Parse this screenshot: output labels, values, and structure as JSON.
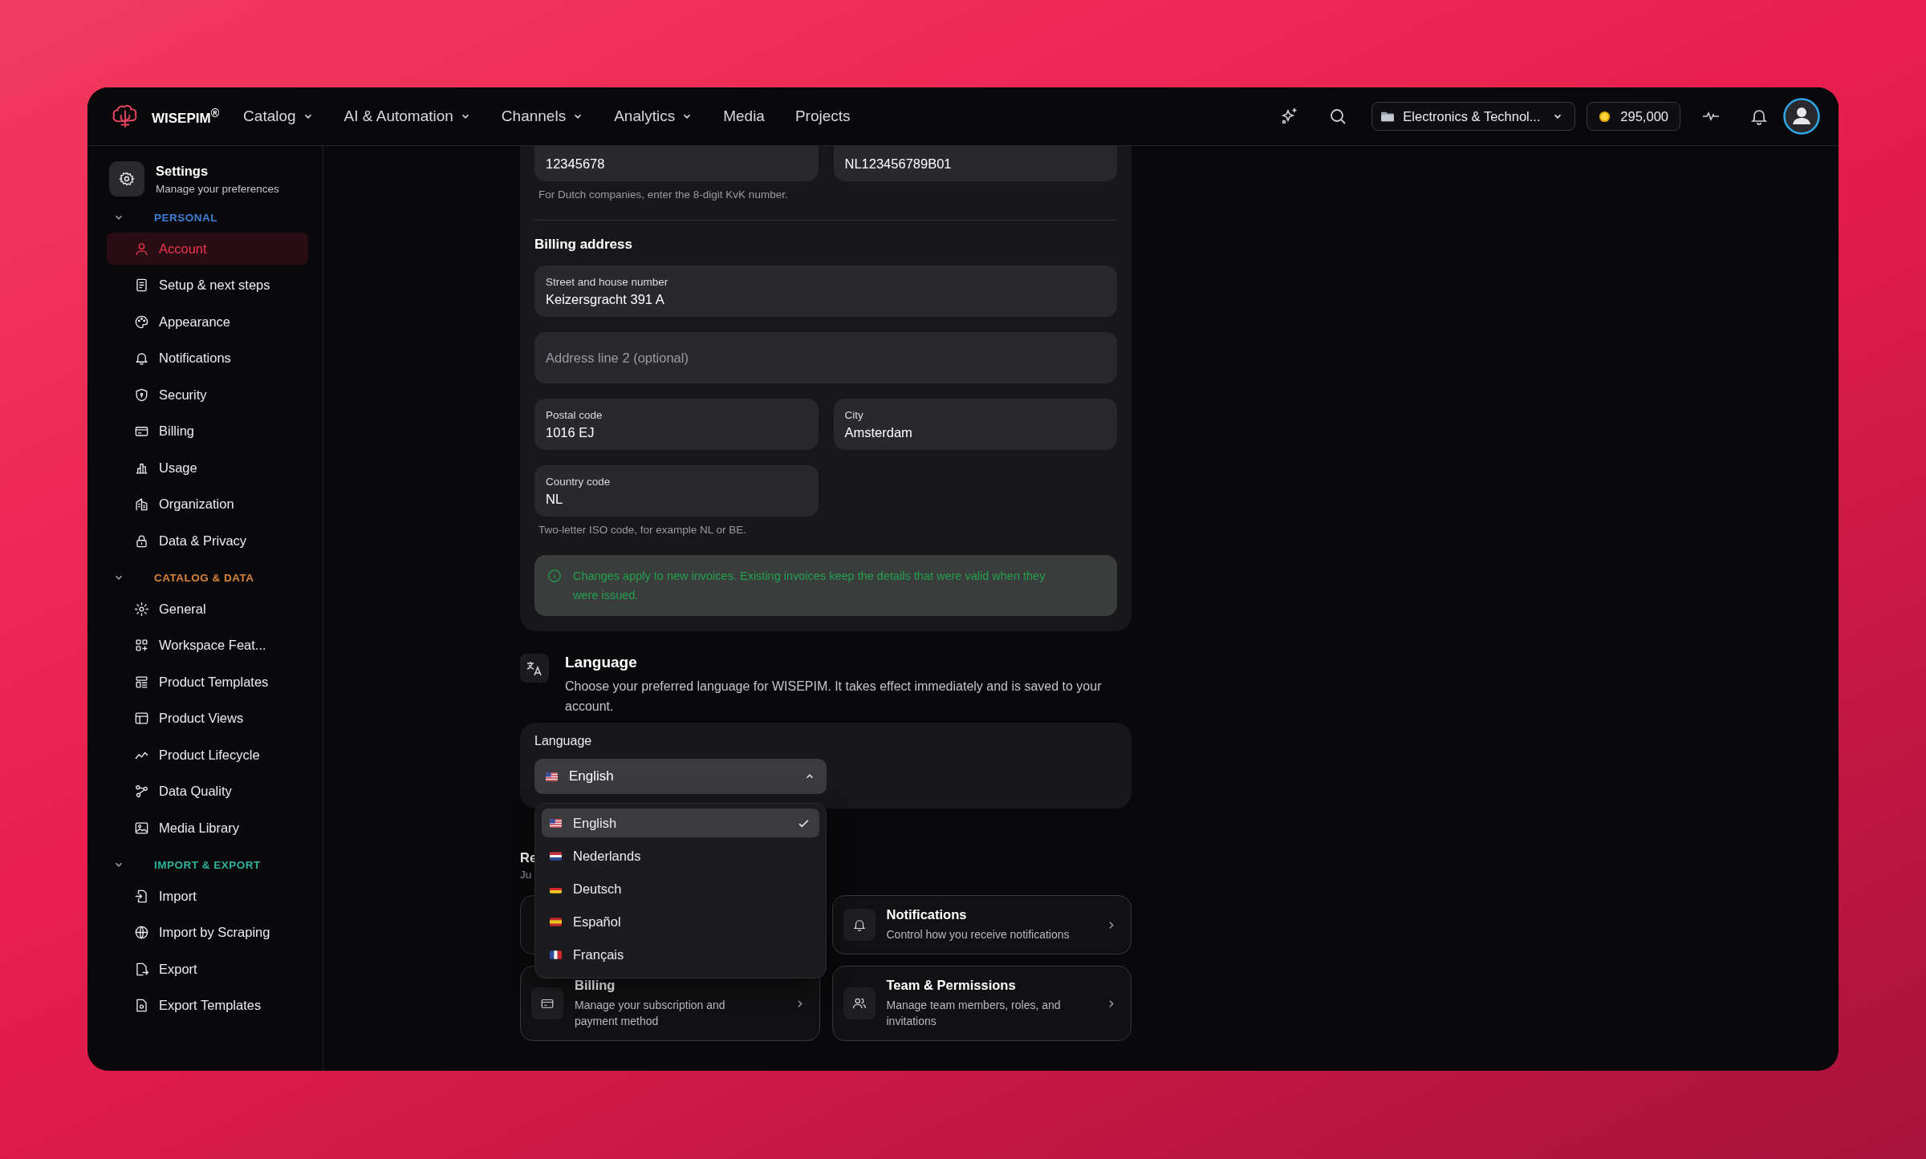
{
  "nav": {
    "brand": "WISEPIM$^{®}$",
    "items": [
      {
        "label": "Catalog",
        "has_menu": true
      },
      {
        "label": "AI & Automation",
        "has_menu": true
      },
      {
        "label": "Channels",
        "has_menu": true
      },
      {
        "label": "Analytics",
        "has_menu": true
      },
      {
        "label": "Media",
        "has_menu": false
      },
      {
        "label": "Projects",
        "has_menu": false
      }
    ],
    "workspace": "Electronics & Technol...",
    "credits": "295,000"
  },
  "sidebar": {
    "title": "Settings",
    "subtitle": "Manage your preferences",
    "sections": [
      {
        "label": "PERSONAL",
        "color": "#3f7fd6",
        "expanded": true,
        "items": [
          {
            "label": "Account",
            "selected": true
          },
          {
            "label": "Setup & next steps",
            "selected": false
          },
          {
            "label": "Appearance",
            "selected": false
          },
          {
            "label": "Notifications",
            "selected": false
          },
          {
            "label": "Security",
            "selected": false
          },
          {
            "label": "Billing",
            "selected": false
          },
          {
            "label": "Usage",
            "selected": false
          },
          {
            "label": "Organization",
            "selected": false
          },
          {
            "label": "Data & Privacy",
            "selected": false
          }
        ]
      },
      {
        "label": "CATALOG & DATA",
        "color": "#d9843a",
        "expanded": true,
        "items": [
          {
            "label": "General",
            "selected": false
          },
          {
            "label": "Workspace Feat...",
            "selected": false
          },
          {
            "label": "Product Templates",
            "selected": false
          },
          {
            "label": "Product Views",
            "selected": false
          },
          {
            "label": "Product Lifecycle",
            "selected": false
          },
          {
            "label": "Data Quality",
            "selected": false
          },
          {
            "label": "Media Library",
            "selected": false
          }
        ]
      },
      {
        "label": "IMPORT & EXPORT",
        "color": "#2fb39c",
        "expanded": true,
        "items": [
          {
            "label": "Import",
            "selected": false
          },
          {
            "label": "Import by Scraping",
            "selected": false
          },
          {
            "label": "Export",
            "selected": false
          },
          {
            "label": "Export Templates",
            "selected": false
          }
        ]
      }
    ]
  },
  "billing_form": {
    "top_fields": [
      {
        "value": "12345678"
      },
      {
        "value": "NL123456789B01"
      }
    ],
    "top_hint": "For Dutch companies, enter the 8-digit KvK number.",
    "section_title": "Billing address",
    "fields": [
      {
        "label": "Street and house number",
        "value": "Keizersgracht 391 A",
        "full_width": true
      },
      {
        "placeholder": "Address line 2 (optional)",
        "full_width": true
      },
      {
        "label": "Postal code",
        "value": "1016 EJ",
        "full_width": false
      },
      {
        "label": "City",
        "value": "Amsterdam",
        "full_width": false
      },
      {
        "label": "Country code",
        "value": "NL",
        "full_width": false
      }
    ],
    "bottom_hint": "Two-letter ISO code, for example NL or BE.",
    "notice": "Changes apply to new invoices. Existing invoices keep the details that were valid when they were issued."
  },
  "language_section": {
    "title": "Language",
    "description": "Choose your preferred language for WISEPIM. It takes effect immediately and is saved to your account.",
    "field_label": "Language",
    "value": "English",
    "expanded": true,
    "options": [
      {
        "label": "English",
        "selected": true
      },
      {
        "label": "Nederlands",
        "selected": false
      },
      {
        "label": "Deutsch",
        "selected": false
      },
      {
        "label": "Español",
        "selected": false
      },
      {
        "label": "Français",
        "selected": false
      }
    ]
  },
  "related": {
    "title": "Re",
    "subtitle": "Ju",
    "cards": [
      {
        "title": "Notifications",
        "description": "Control how you receive notifications"
      },
      {
        "title": "Billing",
        "description": "Manage your subscription and payment method"
      },
      {
        "title": "Team & Permissions",
        "description": "Manage team members, roles, and invitations"
      }
    ]
  }
}
